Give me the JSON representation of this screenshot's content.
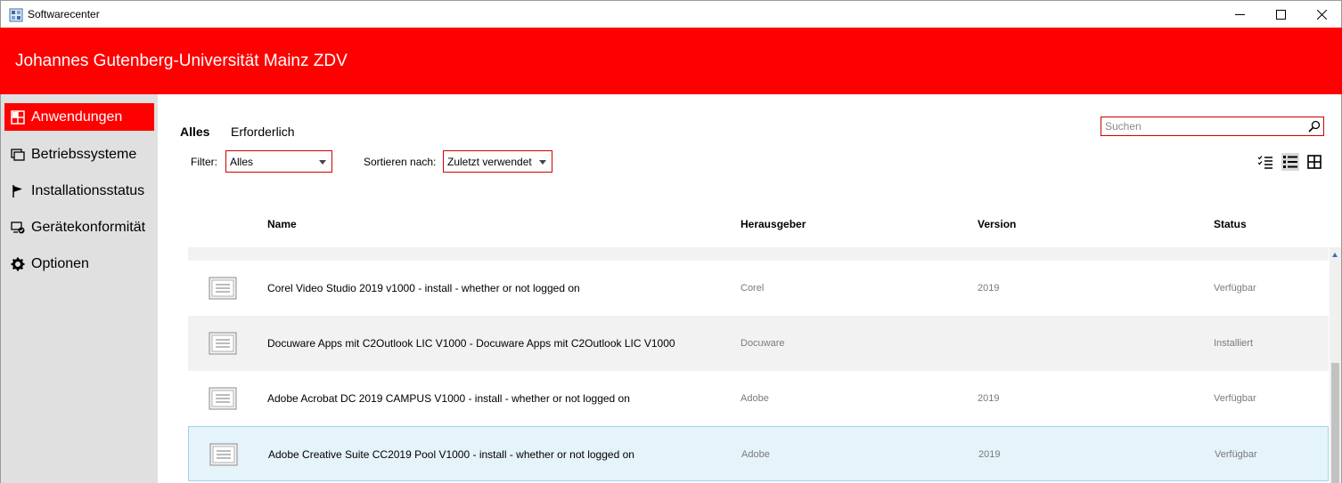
{
  "window": {
    "title": "Softwarecenter"
  },
  "banner": {
    "title": "Johannes Gutenberg-Universität Mainz ZDV",
    "color": "#ff0000"
  },
  "sidebar": {
    "items": [
      {
        "label": "Anwendungen",
        "icon": "applications-grid-icon",
        "active": true
      },
      {
        "label": "Betriebssysteme",
        "icon": "operating-systems-icon",
        "active": false
      },
      {
        "label": "Installationsstatus",
        "icon": "flag-icon",
        "active": false
      },
      {
        "label": "Gerätekonformität",
        "icon": "device-compliance-icon",
        "active": false
      },
      {
        "label": "Optionen",
        "icon": "gear-icon",
        "active": false
      }
    ]
  },
  "tabs": [
    {
      "label": "Alles",
      "active": true
    },
    {
      "label": "Erforderlich",
      "active": false
    }
  ],
  "search": {
    "placeholder": "Suchen",
    "value": ""
  },
  "filter": {
    "label": "Filter:",
    "value": "Alles"
  },
  "sort": {
    "label": "Sortieren nach:",
    "value": "Zuletzt verwendet"
  },
  "columns": {
    "name": "Name",
    "publisher": "Herausgeber",
    "version": "Version",
    "status": "Status"
  },
  "rows": [
    {
      "name": "Corel Video Studio 2019 v1000 - install - whether or not logged on",
      "publisher": "Corel",
      "version": "2019",
      "status": "Verfügbar"
    },
    {
      "name": "Docuware Apps mit C2Outlook LIC V1000 - Docuware Apps mit C2Outlook LIC V1000",
      "publisher": "Docuware",
      "version": "",
      "status": "Installiert"
    },
    {
      "name": "Adobe Acrobat DC 2019 CAMPUS V1000 - install - whether or not logged on",
      "publisher": "Adobe",
      "version": "2019",
      "status": "Verfügbar"
    },
    {
      "name": "Adobe Creative Suite CC2019 Pool V1000 - install - whether or not logged on",
      "publisher": "Adobe",
      "version": "2019",
      "status": "Verfügbar",
      "selected": true
    }
  ]
}
